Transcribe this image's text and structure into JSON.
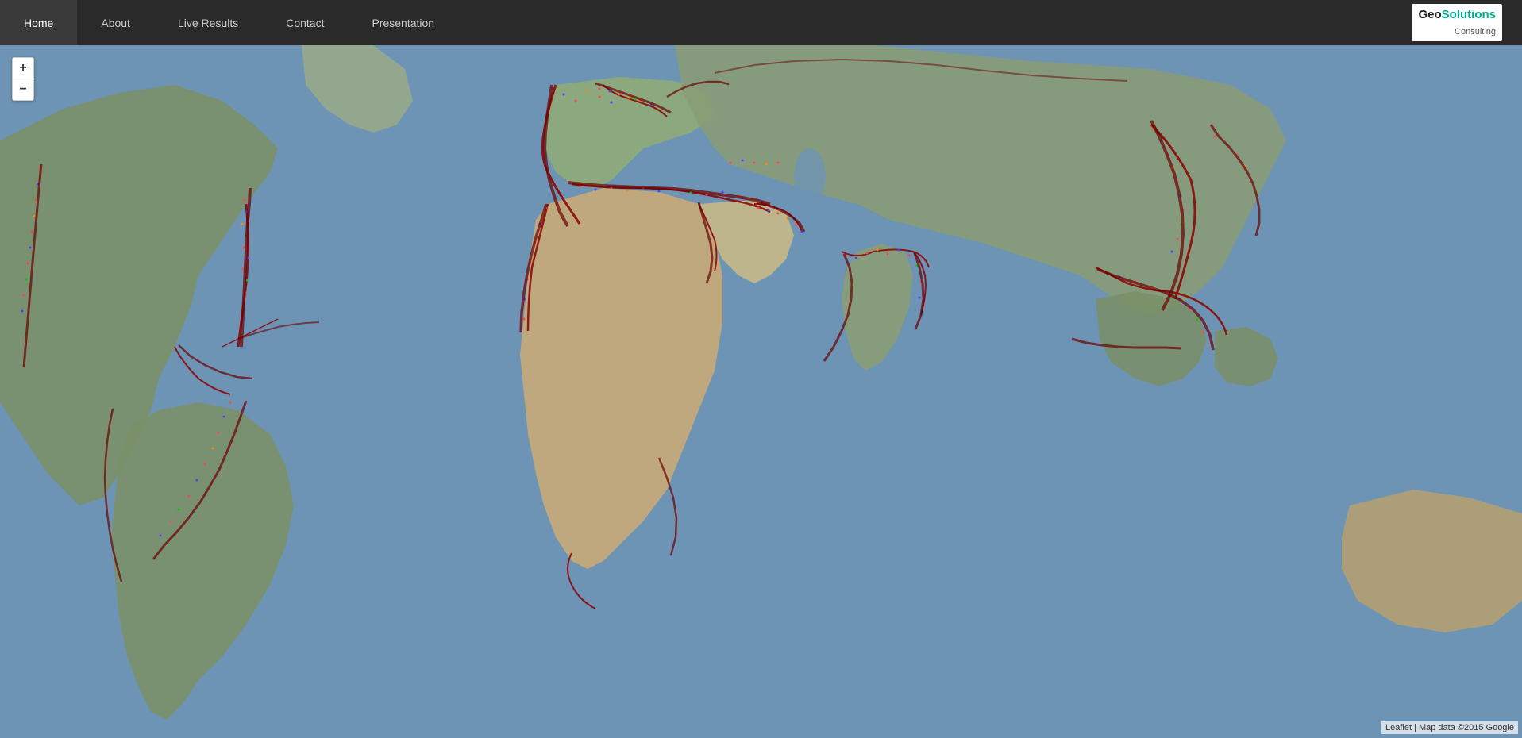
{
  "navbar": {
    "items": [
      {
        "label": "Home",
        "id": "home"
      },
      {
        "label": "About",
        "id": "about"
      },
      {
        "label": "Live Results",
        "id": "live-results"
      },
      {
        "label": "Contact",
        "id": "contact"
      },
      {
        "label": "Presentation",
        "id": "presentation"
      }
    ],
    "logo": {
      "geo": "Geo",
      "solutions": "Solutions",
      "consulting": "Consulting"
    }
  },
  "map": {
    "zoom_in_label": "+",
    "zoom_out_label": "−",
    "attribution": "Leaflet | Map data ©2015 Google"
  }
}
